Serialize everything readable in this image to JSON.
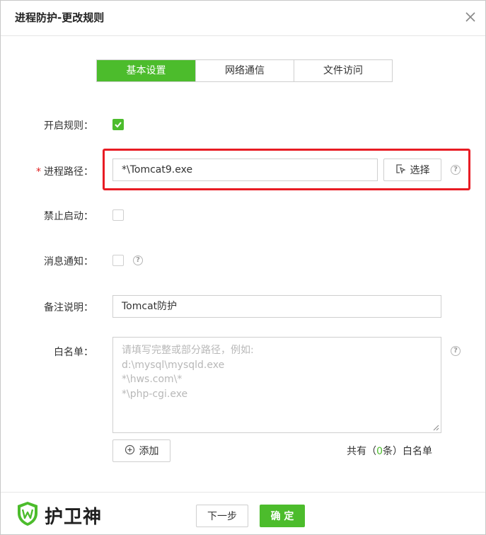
{
  "dialog": {
    "title": "进程防护-更改规则",
    "close_icon": "close-icon"
  },
  "tabs": [
    {
      "label": "基本设置",
      "active": true
    },
    {
      "label": "网络通信",
      "active": false
    },
    {
      "label": "文件访问",
      "active": false
    }
  ],
  "form": {
    "enable_rule": {
      "label": "开启规则：",
      "checked": true
    },
    "process_path": {
      "required_mark": "*",
      "label": "进程路径：",
      "value": "*\\Tomcat9.exe",
      "select_button": "选择"
    },
    "block_start": {
      "label": "禁止启动：",
      "checked": false
    },
    "notify": {
      "label": "消息通知：",
      "checked": false
    },
    "remark": {
      "label": "备注说明：",
      "value": "Tomcat防护"
    },
    "whitelist": {
      "label": "白名单：",
      "placeholder_lines": [
        "请填写完整或部分路径，例如:",
        "d:\\mysql\\mysqld.exe",
        "*\\hws.com\\*",
        "*\\php-cgi.exe"
      ],
      "add_button": "添加",
      "count_prefix": "共有（",
      "count_value": "0",
      "count_suffix": "条）白名单"
    }
  },
  "footer": {
    "brand_name": "护卫神",
    "next_button": "下一步",
    "confirm_button": "确 定"
  },
  "colors": {
    "accent": "#4cbc2c",
    "highlight_border": "#e81c24"
  }
}
